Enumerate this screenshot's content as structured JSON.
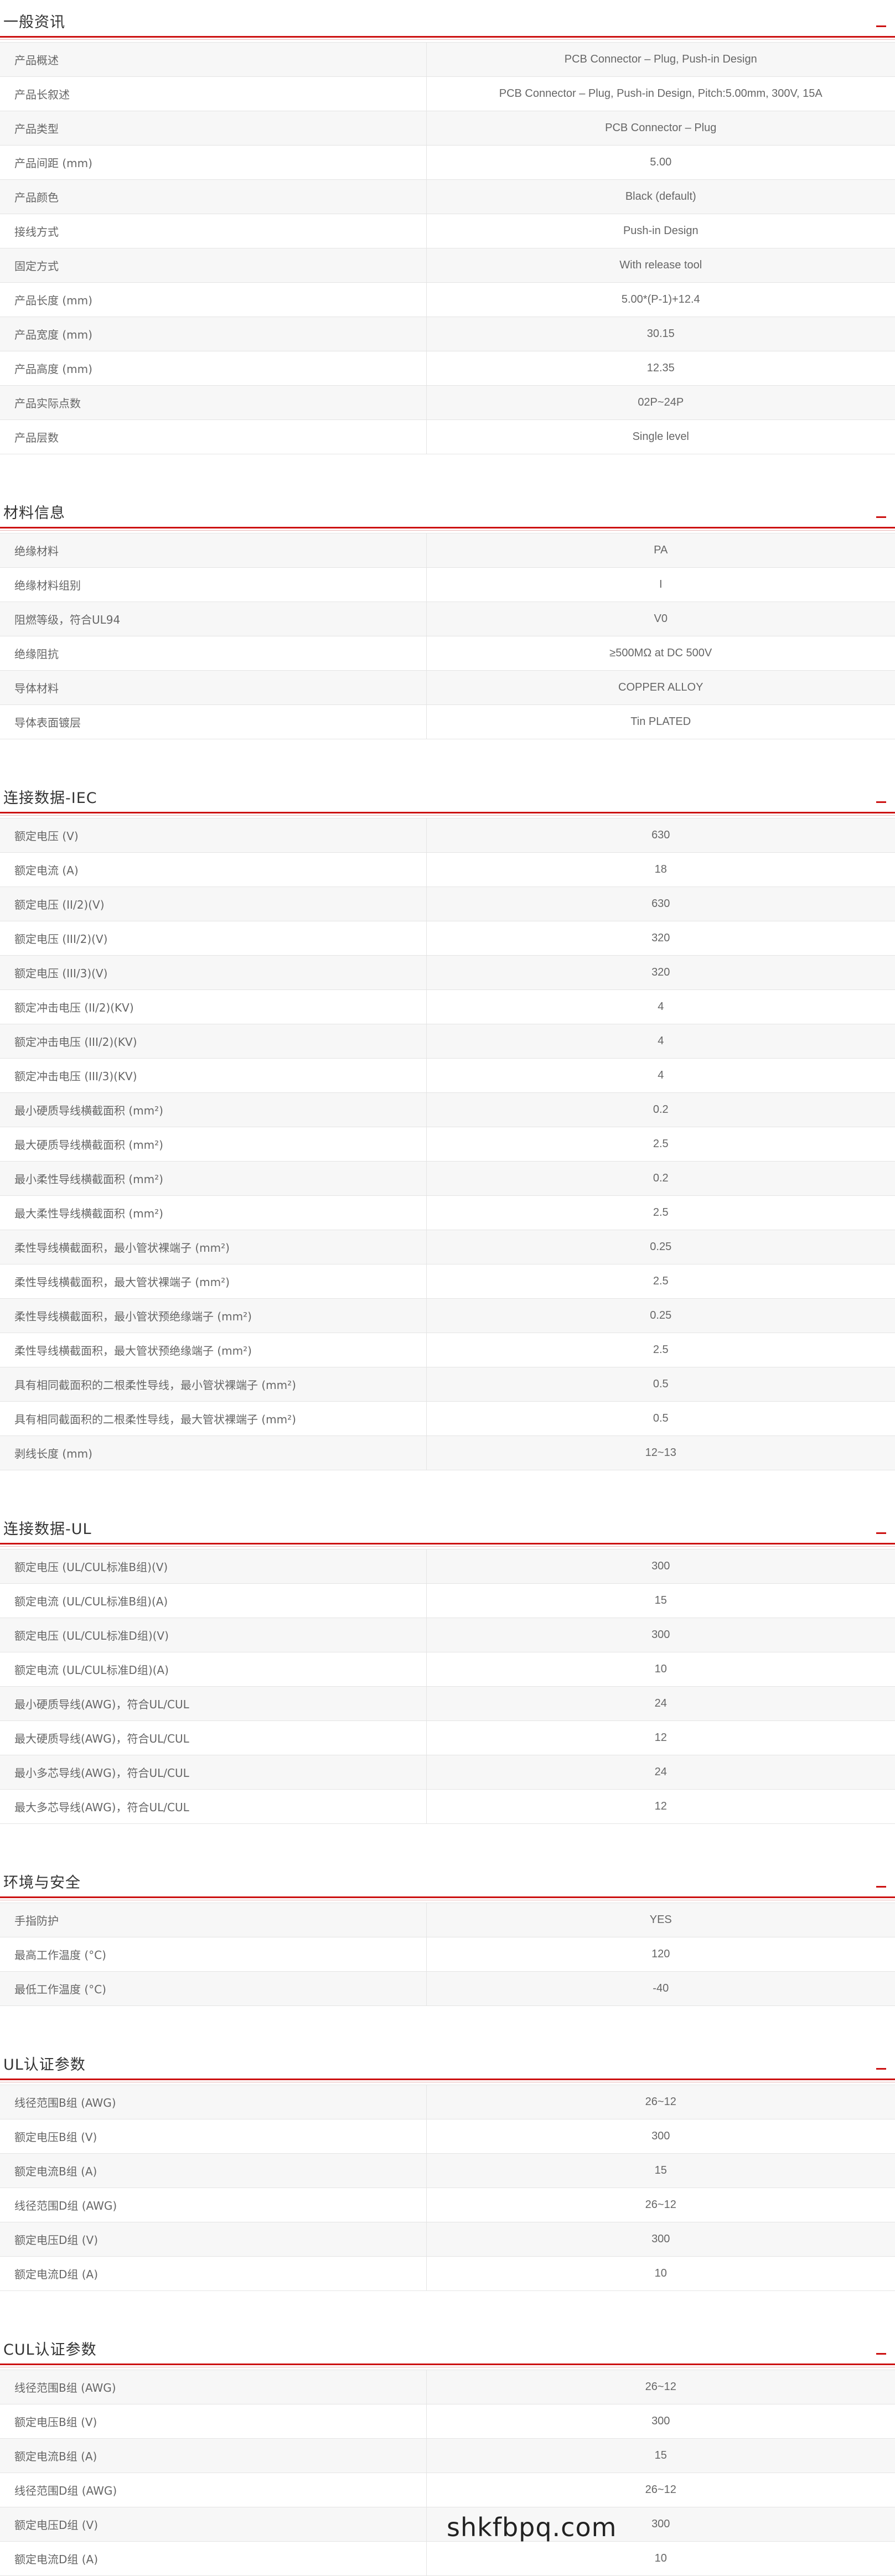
{
  "sections": [
    {
      "title": "一般资讯",
      "rows": [
        [
          "产品概述",
          "PCB Connector – Plug, Push-in Design"
        ],
        [
          "产品长叙述",
          "PCB Connector – Plug, Push-in Design, Pitch:5.00mm, 300V, 15A"
        ],
        [
          "产品类型",
          "PCB Connector – Plug"
        ],
        [
          "产品间距 (mm)",
          "5.00"
        ],
        [
          "产品颜色",
          "Black (default)"
        ],
        [
          "接线方式",
          "Push-in Design"
        ],
        [
          "固定方式",
          "With release tool"
        ],
        [
          "产品长度 (mm)",
          "5.00*(P-1)+12.4"
        ],
        [
          "产品宽度 (mm)",
          "30.15"
        ],
        [
          "产品高度 (mm)",
          "12.35"
        ],
        [
          "产品实际点数",
          "02P~24P"
        ],
        [
          "产品层数",
          "Single level"
        ]
      ]
    },
    {
      "title": "材料信息",
      "rows": [
        [
          "绝缘材料",
          "PA"
        ],
        [
          "绝缘材料组别",
          "I"
        ],
        [
          "阻燃等级，符合UL94",
          "V0"
        ],
        [
          "绝缘阻抗",
          "≥500MΩ at DC 500V"
        ],
        [
          "导体材料",
          "COPPER ALLOY"
        ],
        [
          "导体表面镀层",
          "Tin PLATED"
        ]
      ]
    },
    {
      "title": "连接数据-IEC",
      "rows": [
        [
          "额定电压 (V)",
          "630"
        ],
        [
          "额定电流 (A)",
          "18"
        ],
        [
          "额定电压 (II/2)(V)",
          "630"
        ],
        [
          "额定电压 (III/2)(V)",
          "320"
        ],
        [
          "额定电压 (III/3)(V)",
          "320"
        ],
        [
          "额定冲击电压 (II/2)(KV)",
          "4"
        ],
        [
          "额定冲击电压 (III/2)(KV)",
          "4"
        ],
        [
          "额定冲击电压 (III/3)(KV)",
          "4"
        ],
        [
          "最小硬质导线横截面积 (mm²)",
          "0.2"
        ],
        [
          "最大硬质导线横截面积 (mm²)",
          "2.5"
        ],
        [
          "最小柔性导线横截面积 (mm²)",
          "0.2"
        ],
        [
          "最大柔性导线横截面积 (mm²)",
          "2.5"
        ],
        [
          "柔性导线横截面积，最小管状裸端子 (mm²)",
          "0.25"
        ],
        [
          "柔性导线横截面积，最大管状裸端子 (mm²)",
          "2.5"
        ],
        [
          "柔性导线横截面积，最小管状预绝缘端子 (mm²)",
          "0.25"
        ],
        [
          "柔性导线横截面积，最大管状预绝缘端子 (mm²)",
          "2.5"
        ],
        [
          "具有相同截面积的二根柔性导线，最小管状裸端子 (mm²)",
          "0.5"
        ],
        [
          "具有相同截面积的二根柔性导线，最大管状裸端子 (mm²)",
          "0.5"
        ],
        [
          "剥线长度 (mm)",
          "12~13"
        ]
      ]
    },
    {
      "title": "连接数据-UL",
      "rows": [
        [
          "额定电压 (UL/CUL标准B组)(V)",
          "300"
        ],
        [
          "额定电流 (UL/CUL标准B组)(A)",
          "15"
        ],
        [
          "额定电压 (UL/CUL标准D组)(V)",
          "300"
        ],
        [
          "额定电流 (UL/CUL标准D组)(A)",
          "10"
        ],
        [
          "最小硬质导线(AWG)，符合UL/CUL",
          "24"
        ],
        [
          "最大硬质导线(AWG)，符合UL/CUL",
          "12"
        ],
        [
          "最小多芯导线(AWG)，符合UL/CUL",
          "24"
        ],
        [
          "最大多芯导线(AWG)，符合UL/CUL",
          "12"
        ]
      ]
    },
    {
      "title": "环境与安全",
      "rows": [
        [
          "手指防护",
          "YES"
        ],
        [
          "最高工作温度 (°C)",
          "120"
        ],
        [
          "最低工作温度 (°C)",
          "-40"
        ]
      ]
    },
    {
      "title": "UL认证参数",
      "rows": [
        [
          "线径范围B组 (AWG)",
          "26~12"
        ],
        [
          "额定电压B组 (V)",
          "300"
        ],
        [
          "额定电流B组 (A)",
          "15"
        ],
        [
          "线径范围D组 (AWG)",
          "26~12"
        ],
        [
          "额定电压D组 (V)",
          "300"
        ],
        [
          "额定电流D组 (A)",
          "10"
        ]
      ]
    },
    {
      "title": "CUL认证参数",
      "rows": [
        [
          "线径范围B组 (AWG)",
          "26~12"
        ],
        [
          "额定电压B组 (V)",
          "300"
        ],
        [
          "额定电流B组 (A)",
          "15"
        ],
        [
          "线径范围D组 (AWG)",
          "26~12"
        ],
        [
          "额定电压D组 (V)",
          "300"
        ],
        [
          "额定电流D组 (A)",
          "10"
        ]
      ]
    }
  ],
  "watermark": "shkfbpq.com",
  "colors": {
    "accent": "#cc1111",
    "row_alt": "#f7f7f7",
    "border": "#e4e4e4"
  },
  "icons": {
    "collapse": "minus-icon"
  }
}
